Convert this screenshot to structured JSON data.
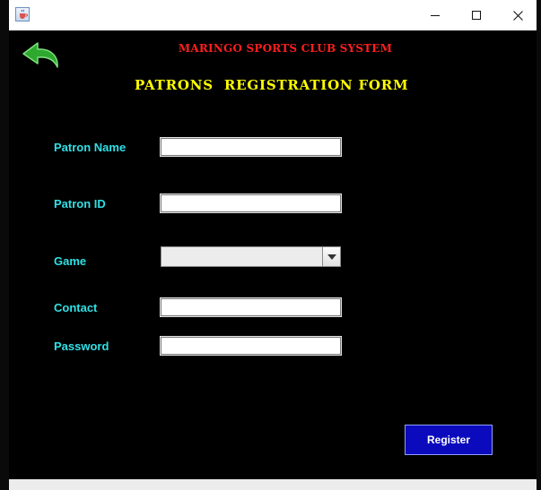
{
  "window": {
    "icon": "java-cup-icon",
    "controls": {
      "minimize": "minimize-icon",
      "maximize": "maximize-icon",
      "close": "close-icon"
    }
  },
  "header": {
    "back_icon": "back-arrow-icon",
    "system_title": "MARINGO SPORTS CLUB SYSTEM",
    "form_title": "PATRONS  REGISTRATION FORM"
  },
  "form": {
    "patron_name": {
      "label": "Patron Name",
      "value": ""
    },
    "patron_id": {
      "label": "Patron ID",
      "value": ""
    },
    "game": {
      "label": "Game",
      "selected": ""
    },
    "contact": {
      "label": "Contact",
      "value": ""
    },
    "password": {
      "label": "Password",
      "value": ""
    },
    "register_label": "Register"
  },
  "colors": {
    "background": "#000000",
    "system_title": "#ff1e1e",
    "form_title": "#ffff00",
    "labels": "#2fe0e6",
    "register_button": "#0b0bbd",
    "back_icon": "#2ea82e"
  }
}
